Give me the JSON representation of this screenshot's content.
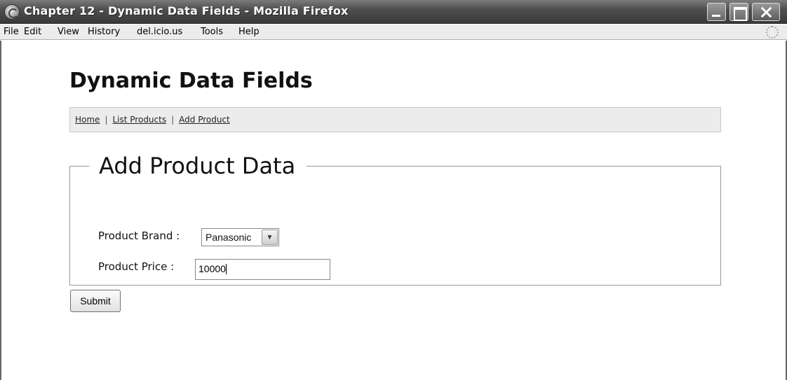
{
  "window": {
    "title": "Chapter 12 - Dynamic Data Fields - Mozilla Firefox",
    "buttons": [
      "minimize",
      "maximize",
      "close"
    ]
  },
  "menu": {
    "items": [
      "File",
      "Edit",
      "View",
      "History",
      "del.icio.us",
      "Tools",
      "Help"
    ]
  },
  "page": {
    "heading": "Dynamic Data Fields",
    "nav": {
      "links": [
        "Home",
        "List Products",
        "Add Product"
      ],
      "separator": "|"
    },
    "form": {
      "legend": "Add Product Data",
      "brand_label": "Product Brand :",
      "brand_selected": "Panasonic",
      "price_label": "Product Price :",
      "price_value": "10000",
      "submit_label": "Submit"
    }
  },
  "icons": {
    "app": "firefox-icon",
    "throbber": "throbber-icon",
    "dropdown": "chevron-down-icon"
  }
}
